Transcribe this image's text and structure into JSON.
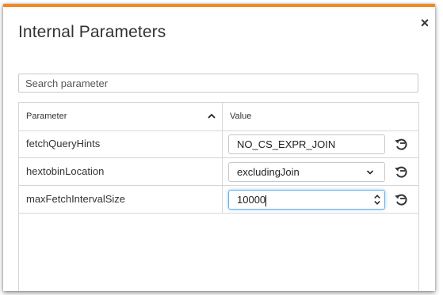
{
  "dialog": {
    "title": "Internal Parameters",
    "close_glyph": "×",
    "accent_color": "#f08a24"
  },
  "search": {
    "placeholder": "Search parameter",
    "value": ""
  },
  "table": {
    "columns": {
      "parameter": "Parameter",
      "value": "Value"
    },
    "sort_icon": "chevron-up-icon",
    "rows": [
      {
        "name": "fetchQueryHints",
        "control": "text",
        "value": "NO_CS_EXPR_JOIN",
        "reset_icon": "reset-icon"
      },
      {
        "name": "hextobinLocation",
        "control": "select",
        "value": "excludingJoin",
        "reset_icon": "reset-icon"
      },
      {
        "name": "maxFetchIntervalSize",
        "control": "number",
        "value": "10000",
        "reset_icon": "reset-icon"
      }
    ]
  }
}
